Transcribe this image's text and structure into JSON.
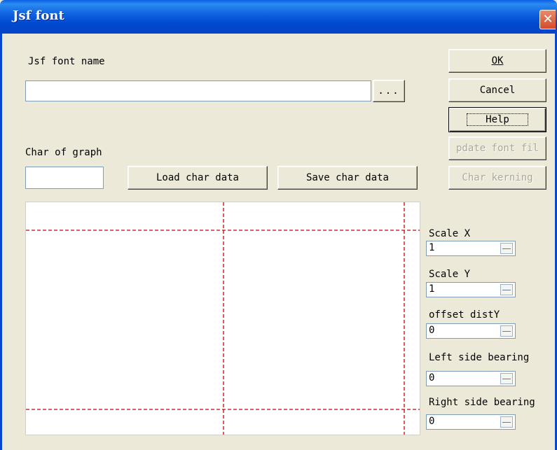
{
  "window": {
    "title": "Jsf font"
  },
  "font_name": {
    "label": "Jsf font name",
    "value": "",
    "browse_label": "..."
  },
  "buttons": {
    "ok": "OK",
    "cancel": "Cancel",
    "help": "Help",
    "update_font": "pdate font fil",
    "char_kerning": "Char kerning",
    "load_char": "Load char data",
    "save_char": "Save char data"
  },
  "char_of_graph": {
    "label": "Char of graph",
    "value": ""
  },
  "params": [
    {
      "label": "Scale X",
      "value": "1"
    },
    {
      "label": "Scale Y",
      "value": "1"
    },
    {
      "label": "offset distY",
      "value": "0"
    },
    {
      "label": "Left side bearing",
      "value": "0"
    },
    {
      "label": "Right side bearing",
      "value": "0"
    }
  ],
  "colors": {
    "guide_line": "#d00000",
    "title_bar": "#0a5fe6",
    "face": "#ece9d8"
  }
}
